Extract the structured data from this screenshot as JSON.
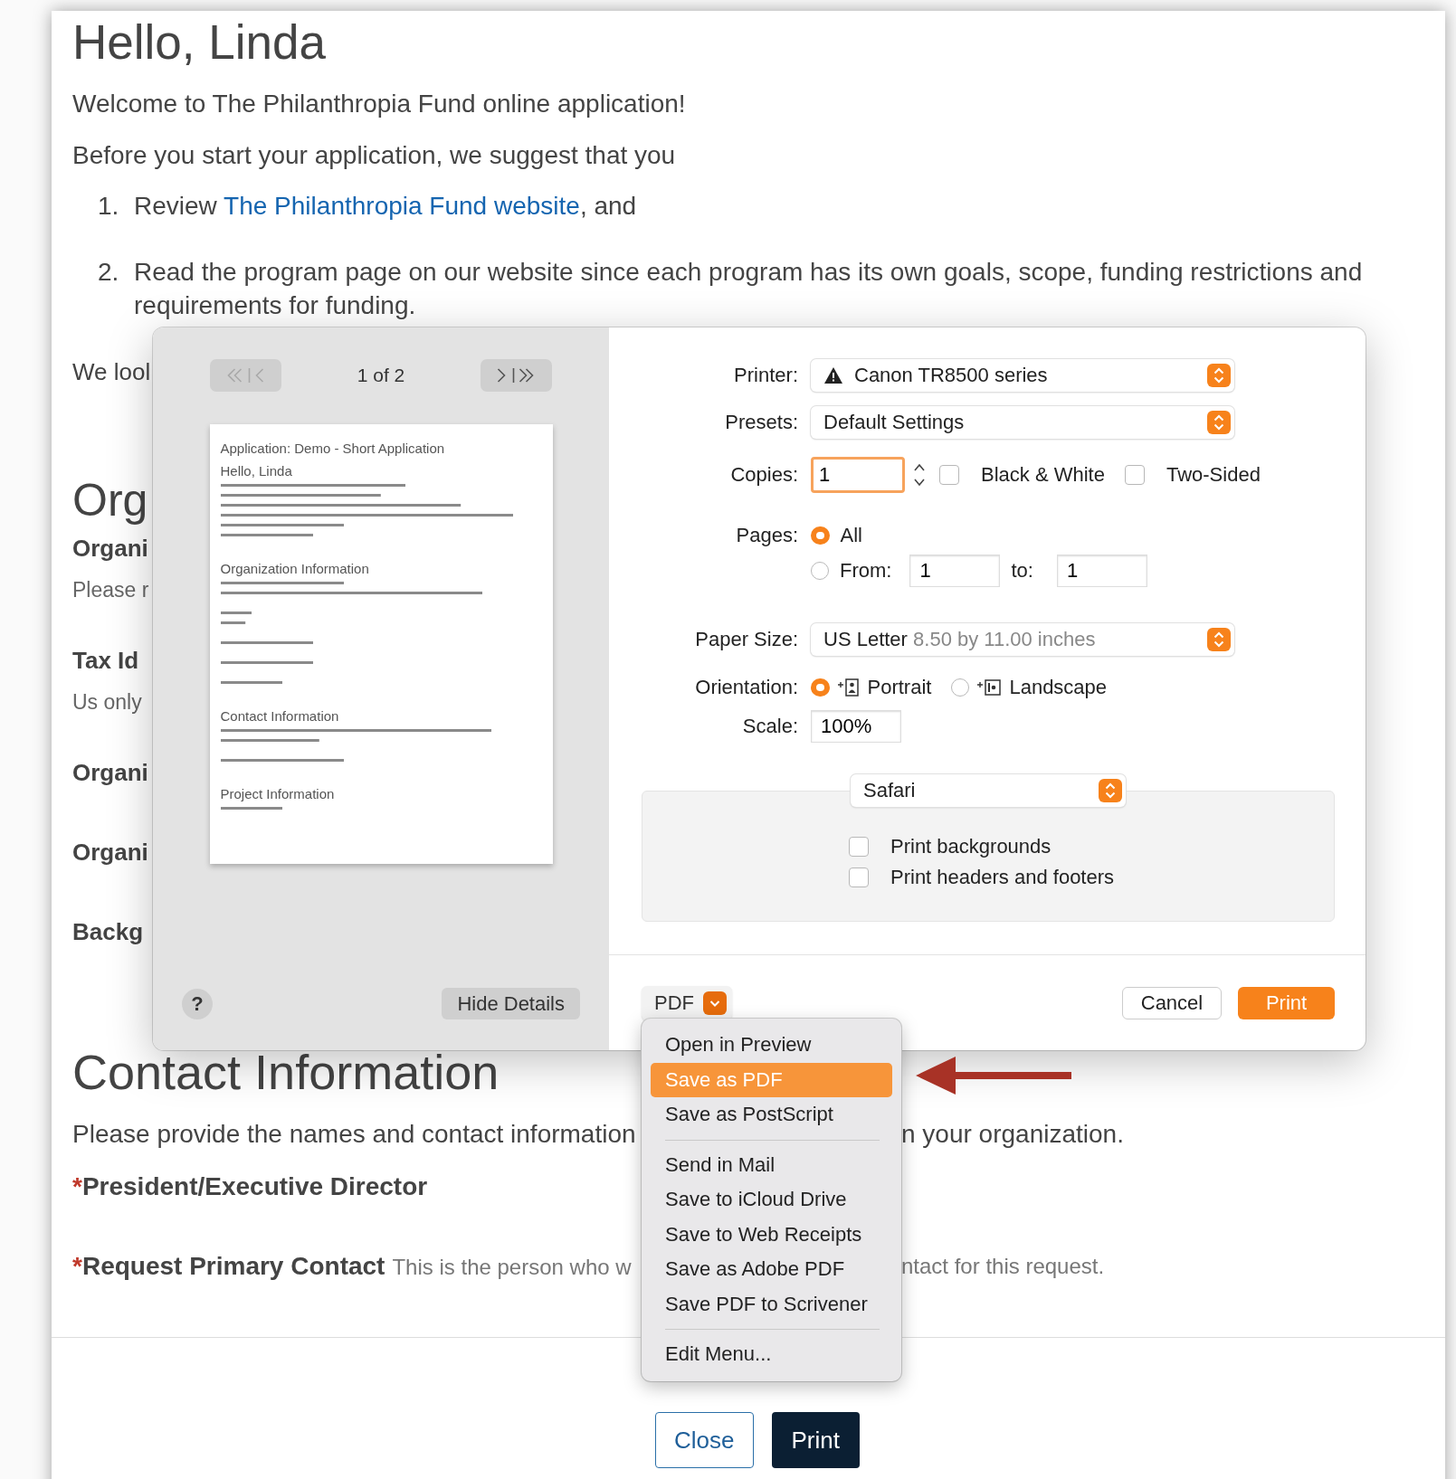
{
  "page": {
    "greeting": "Hello, Linda",
    "intro": [
      "Welcome to The Philanthropia Fund online application!",
      "Before you start your application, we suggest that you"
    ],
    "steps": [
      {
        "number": "1.",
        "text": "Review ",
        "link": "The Philanthropia Fund website",
        "after": ", and"
      },
      {
        "number": "2.",
        "text": "Read the program page on our website since each program has its own goals, scope, funding restrictions and requirements for funding."
      }
    ],
    "partly_hidden": [
      {
        "kind": "line",
        "text": "We lool"
      },
      {
        "kind": "heading",
        "text": "Org"
      },
      {
        "kind": "label",
        "text": "Organi"
      },
      {
        "kind": "hint",
        "text": "Please r"
      },
      {
        "kind": "label",
        "text": "Tax Id"
      },
      {
        "kind": "hint",
        "text": "Us only"
      },
      {
        "kind": "label",
        "text": "Organi"
      },
      {
        "kind": "label",
        "text": "Organi"
      },
      {
        "kind": "label",
        "text": "Backg"
      }
    ],
    "contact": {
      "heading": "Contact Information",
      "intro": [
        "Please provide the names and contact information",
        "n your organization."
      ],
      "roles": [
        {
          "marker": "*",
          "label": "President/Executive Director"
        },
        {
          "marker": "*",
          "label": "Request Primary Contact",
          "hint": [
            "This is the person who w",
            "ntact for this request."
          ]
        }
      ]
    },
    "buttons": [
      {
        "kind": "outline",
        "label": "Close"
      },
      {
        "kind": "dark",
        "label": "Print"
      }
    ]
  },
  "print_dialog": {
    "preview": {
      "page_indicator": "1 of 2",
      "thumbnail": {
        "title": "Application: Demo - Short Application",
        "sections": [
          "Hello, Linda",
          "Organization Information",
          "Contact Information",
          "Project Information"
        ]
      },
      "help": "?",
      "hide_details": "Hide Details"
    },
    "printer": {
      "label": "Printer:",
      "value": "Canon TR8500 series"
    },
    "presets": {
      "label": "Presets:",
      "value": "Default Settings"
    },
    "copies": {
      "label": "Copies:",
      "value": "1",
      "options": [
        {
          "label": "Black & White",
          "checked": false
        },
        {
          "label": "Two-Sided",
          "checked": false
        }
      ]
    },
    "pages": {
      "label": "Pages:",
      "choices": [
        {
          "label": "All",
          "selected": true
        },
        {
          "label": "From:",
          "selected": false
        }
      ],
      "from": "1",
      "to_label": "to:",
      "to": "1"
    },
    "paper_size": {
      "label": "Paper Size:",
      "value": "US Letter",
      "detail": "8.50 by 11.00 inches"
    },
    "orientation": {
      "label": "Orientation:",
      "choices": [
        {
          "kind": "portrait",
          "label": "Portrait",
          "selected": true
        },
        {
          "kind": "landscape",
          "label": "Landscape",
          "selected": false
        }
      ]
    },
    "scale": {
      "label": "Scale:",
      "value": "100%"
    },
    "app_section": {
      "value": "Safari",
      "options": [
        {
          "label": "Print backgrounds",
          "checked": false
        },
        {
          "label": "Print headers and footers",
          "checked": false
        }
      ]
    },
    "pdf": "PDF",
    "cancel": "Cancel",
    "print": "Print",
    "pdf_menu": [
      [
        {
          "label": "Open in Preview",
          "selected": false
        },
        {
          "label": "Save as PDF",
          "selected": true
        },
        {
          "label": "Save as PostScript",
          "selected": false
        }
      ],
      [
        {
          "label": "Send in Mail",
          "selected": false
        },
        {
          "label": "Save to iCloud Drive",
          "selected": false
        },
        {
          "label": "Save to Web Receipts",
          "selected": false
        },
        {
          "label": "Save as Adobe PDF",
          "selected": false
        },
        {
          "label": "Save PDF to Scrivener",
          "selected": false
        }
      ],
      [
        {
          "label": "Edit Menu...",
          "selected": false
        }
      ]
    ]
  }
}
